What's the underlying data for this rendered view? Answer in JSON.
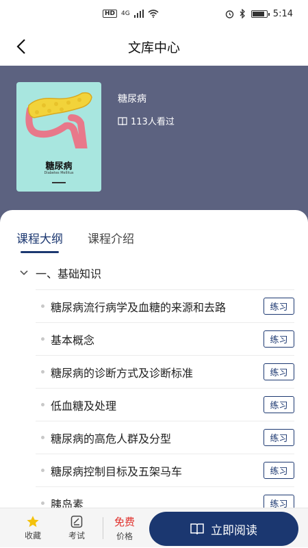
{
  "status": {
    "time": "5:14",
    "network": "4G",
    "hd": "HD"
  },
  "nav": {
    "title": "文库中心"
  },
  "book": {
    "title": "糖尿病",
    "views": "113人看过",
    "cover_title": "糖尿病",
    "cover_subtitle": "Diabetes Mellitus"
  },
  "tabs": [
    {
      "label": "课程大纲",
      "active": true
    },
    {
      "label": "课程介绍",
      "active": false
    }
  ],
  "section": {
    "title": "一、基础知识"
  },
  "items": [
    {
      "title": "糖尿病流行病学及血糖的来源和去路",
      "action": "练习"
    },
    {
      "title": "基本概念",
      "action": "练习"
    },
    {
      "title": "糖尿病的诊断方式及诊断标准",
      "action": "练习"
    },
    {
      "title": "低血糖及处理",
      "action": "练习"
    },
    {
      "title": "糖尿病的高危人群及分型",
      "action": "练习"
    },
    {
      "title": "糖尿病控制目标及五架马车",
      "action": "练习"
    },
    {
      "title": "胰岛素",
      "action": "练习"
    }
  ],
  "bottom": {
    "favorite": "收藏",
    "exam": "考试",
    "price_value": "免费",
    "price_label": "价格",
    "read": "立即阅读"
  },
  "colors": {
    "hero": "#5c6280",
    "accent": "#1b3770",
    "price": "#e0302b",
    "cover": "#a8e6df"
  }
}
